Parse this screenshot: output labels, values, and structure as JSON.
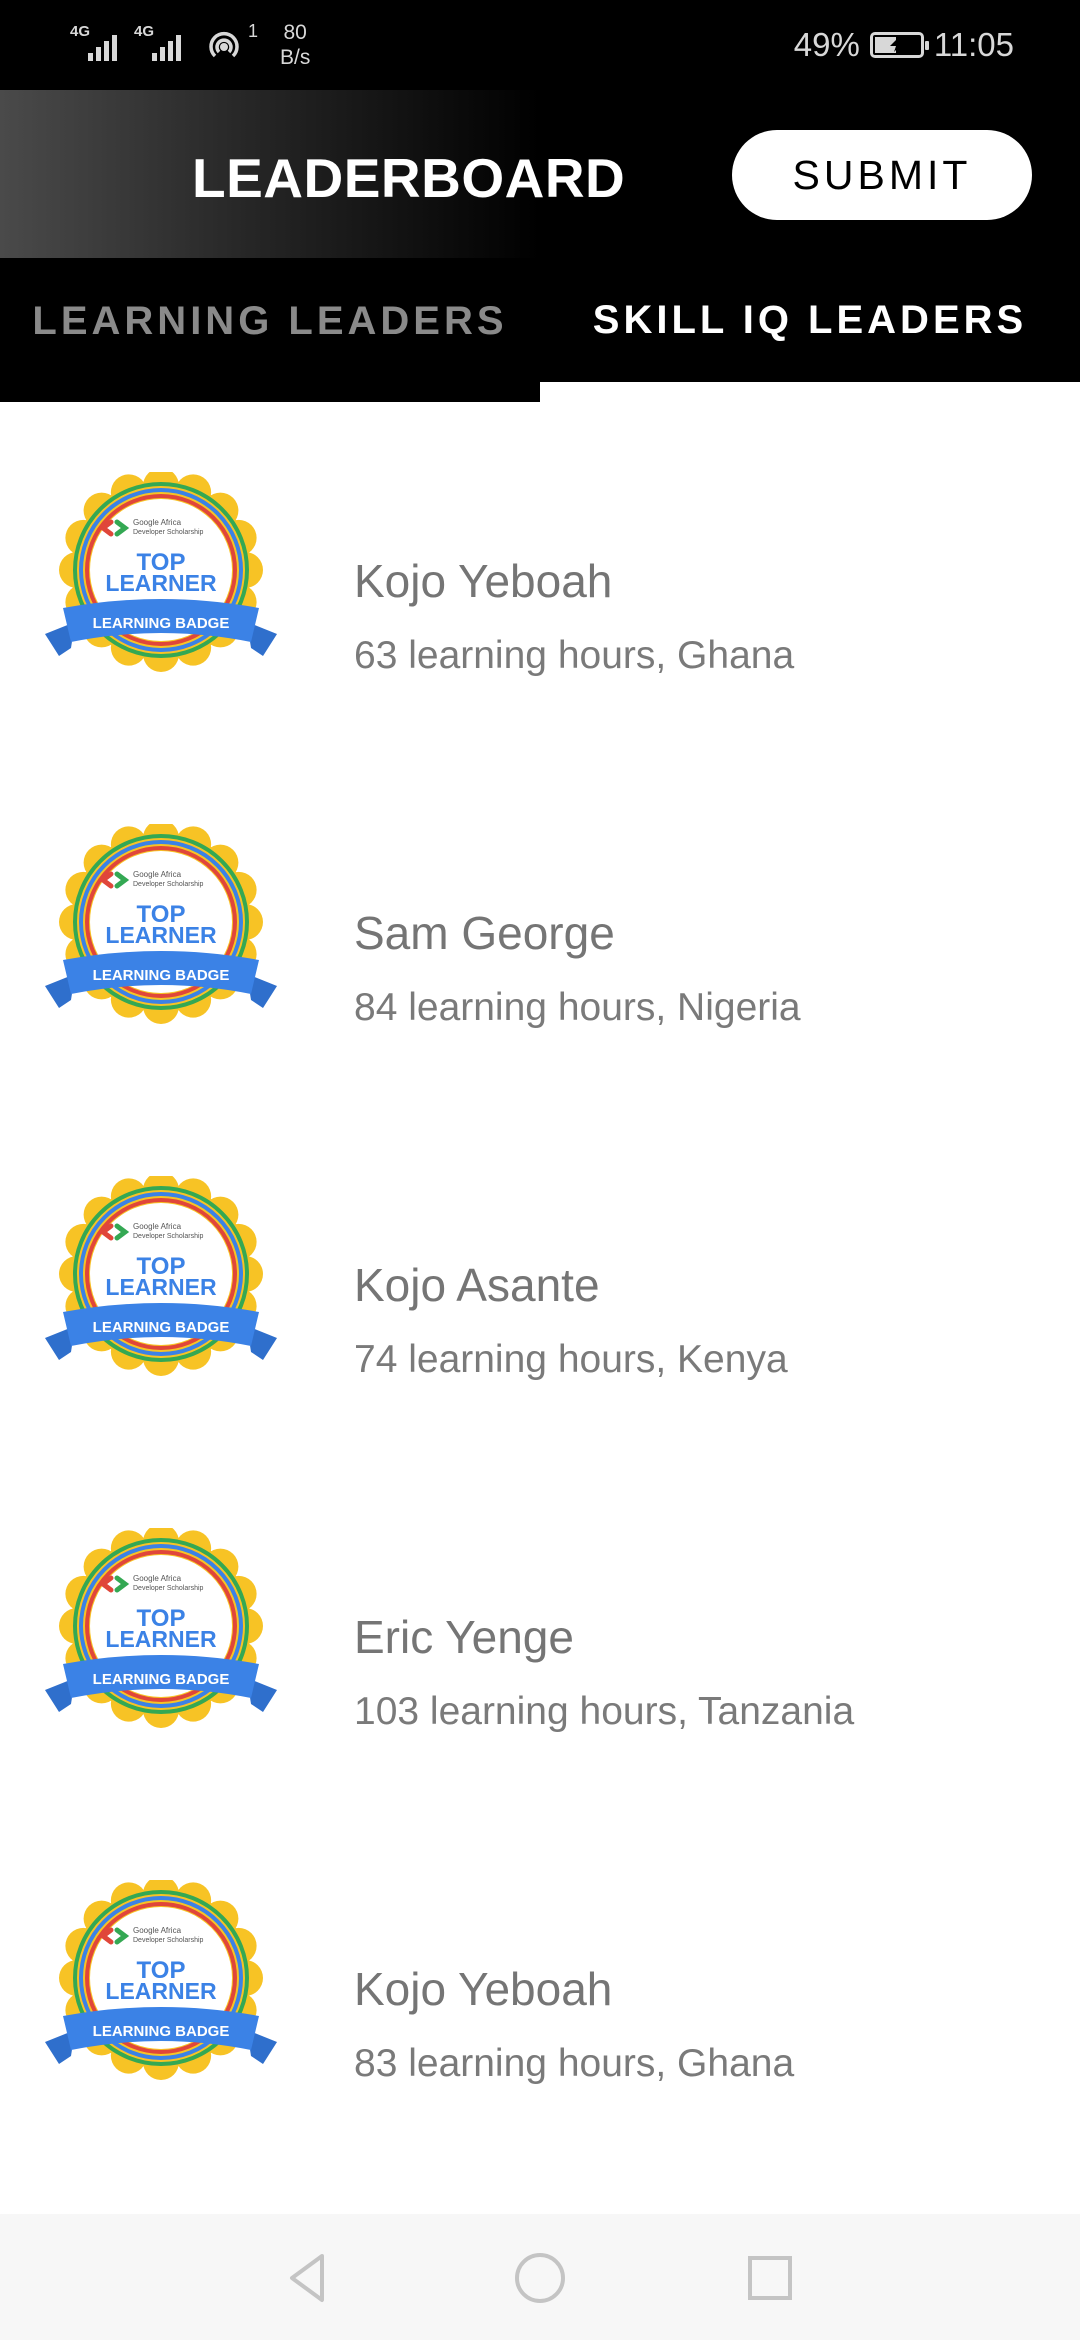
{
  "status_bar": {
    "network_1": "4G",
    "network_2": "4G",
    "hotspot_count": "1",
    "speed_value": "80",
    "speed_unit": "B/s",
    "battery": "49%",
    "time": "11:05"
  },
  "app_bar": {
    "title": "LEADERBOARD",
    "submit_label": "SUBMIT"
  },
  "tabs": [
    {
      "label": "LEARNING LEADERS",
      "selected": false
    },
    {
      "label": "SKILL IQ LEADERS",
      "selected": true
    }
  ],
  "badge": {
    "org_line1": "Google Africa",
    "org_line2": "Developer Scholarship",
    "top": "TOP",
    "learner": "LEARNER",
    "ribbon": "LEARNING BADGE"
  },
  "leaders": [
    {
      "name": "Kojo Yeboah",
      "detail": "63 learning hours, Ghana"
    },
    {
      "name": "Sam George",
      "detail": "84 learning hours, Nigeria"
    },
    {
      "name": "Kojo Asante",
      "detail": "74 learning hours, Kenya"
    },
    {
      "name": "Eric Yenge",
      "detail": "103 learning hours, Tanzania"
    },
    {
      "name": "Kojo Yeboah",
      "detail": "83 learning hours, Ghana"
    }
  ],
  "colors": {
    "badge_gold": "#F7C325",
    "badge_blue": "#3B82E6",
    "badge_red": "#E0463A",
    "badge_green": "#34A853"
  }
}
